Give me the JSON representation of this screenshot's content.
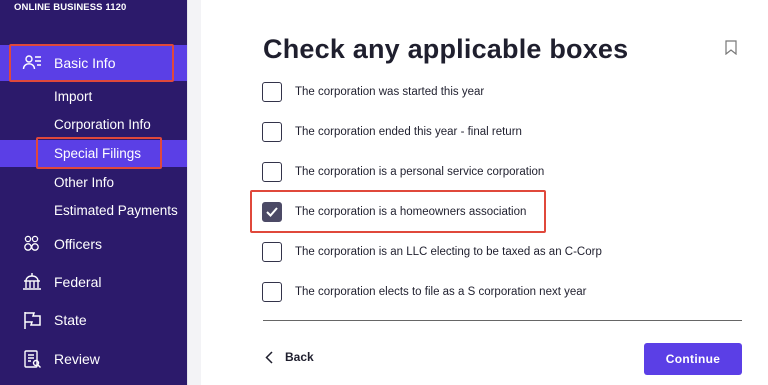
{
  "sidebar": {
    "app_title": "ONLINE BUSINESS 1120",
    "items": [
      {
        "label": "Basic Info",
        "icon": "user-list-icon"
      },
      {
        "label": "Officers",
        "icon": "people-icon"
      },
      {
        "label": "Federal",
        "icon": "capitol-icon"
      },
      {
        "label": "State",
        "icon": "flag-icon"
      },
      {
        "label": "Review",
        "icon": "review-icon"
      }
    ],
    "subitems": [
      {
        "label": "Import"
      },
      {
        "label": "Corporation Info"
      },
      {
        "label": "Special Filings"
      },
      {
        "label": "Other Info"
      },
      {
        "label": "Estimated Payments"
      }
    ]
  },
  "main": {
    "title": "Check any applicable boxes",
    "options": [
      {
        "label": "The corporation was started this year",
        "checked": false
      },
      {
        "label": "The corporation ended this year - final return",
        "checked": false
      },
      {
        "label": "The corporation is a personal service corporation",
        "checked": false
      },
      {
        "label": "The corporation is a homeowners association",
        "checked": true
      },
      {
        "label": "The corporation is an LLC electing to be taxed as an C-Corp",
        "checked": false
      },
      {
        "label": "The corporation elects to file as a S corporation next year",
        "checked": false
      }
    ],
    "back_label": "Back",
    "continue_label": "Continue"
  },
  "colors": {
    "sidebar_bg": "#2c1a6b",
    "active_bg": "#5b3fe6",
    "highlight": "#e0483b",
    "accent": "#5b3fe6"
  }
}
